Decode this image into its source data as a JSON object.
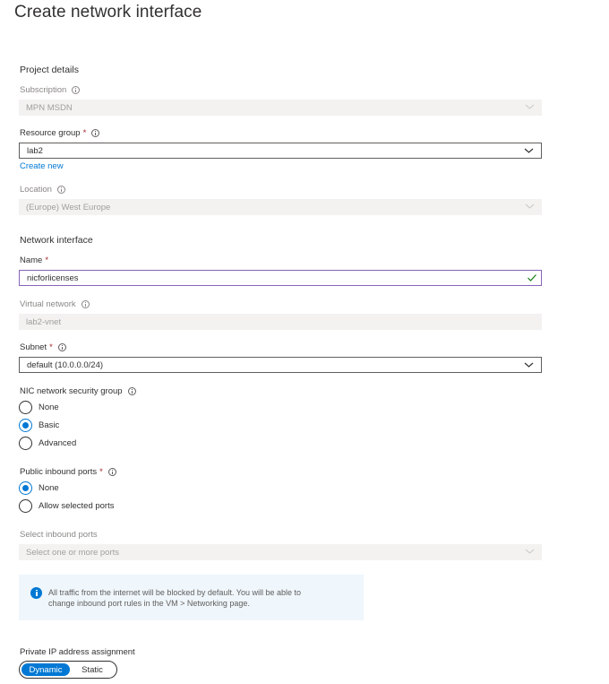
{
  "page": {
    "title": "Create network interface"
  },
  "project_details": {
    "heading": "Project details",
    "subscription": {
      "label": "Subscription",
      "value": "MPN MSDN"
    },
    "resource_group": {
      "label": "Resource group",
      "required": "*",
      "value": "lab2",
      "create_new": "Create new"
    },
    "location": {
      "label": "Location",
      "value": "(Europe) West Europe"
    }
  },
  "network_interface": {
    "heading": "Network interface",
    "name": {
      "label": "Name",
      "required": "*",
      "value": "nicforlicenses"
    },
    "virtual_network": {
      "label": "Virtual network",
      "value": "lab2-vnet"
    },
    "subnet": {
      "label": "Subnet",
      "required": "*",
      "value": "default (10.0.0.0/24)"
    },
    "nsg": {
      "label": "NIC network security group",
      "options": [
        "None",
        "Basic",
        "Advanced"
      ],
      "selected": "Basic"
    },
    "public_ports": {
      "label": "Public inbound ports",
      "required": "*",
      "options": [
        "None",
        "Allow selected ports"
      ],
      "selected": "None"
    },
    "select_ports": {
      "label": "Select inbound ports",
      "placeholder": "Select one or more ports"
    },
    "info_message": {
      "line1": "All traffic from the internet will be blocked by default. You will be able to",
      "line2": "change inbound port rules in the VM > Networking page."
    },
    "private_ip": {
      "label": "Private IP address assignment",
      "options": [
        "Dynamic",
        "Static"
      ],
      "selected": "Dynamic"
    }
  },
  "icons": {
    "info": "info-icon",
    "chevron": "chevron-down-icon",
    "check": "checkmark-icon"
  },
  "colors": {
    "accent": "#0078d4",
    "required": "#a4262c",
    "focus_border": "#8764b8",
    "valid_check": "#107c10",
    "disabled_bg": "#f3f2f1"
  }
}
